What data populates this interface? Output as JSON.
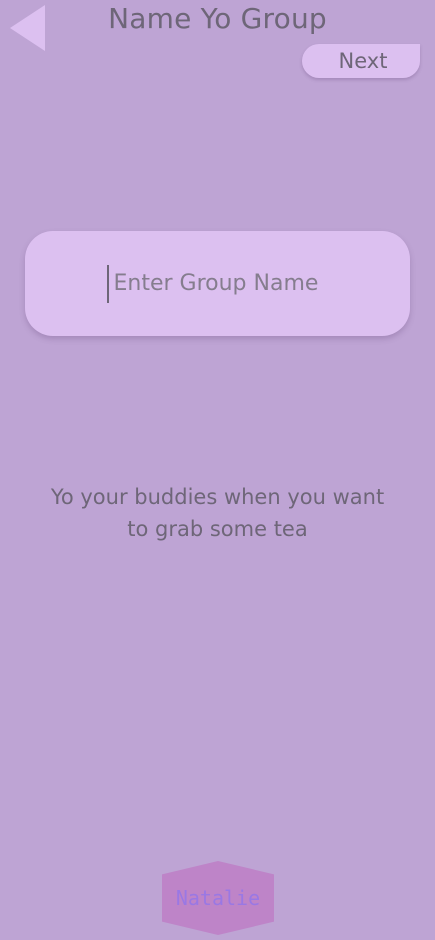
{
  "header": {
    "title": "Name Yo Group",
    "back_icon": "back-arrow-icon",
    "next_label": "Next"
  },
  "group_name": {
    "value": "",
    "placeholder": "Enter Group Name"
  },
  "tagline": "Yo your buddies when you want to grab some tea",
  "user": {
    "name": "Natalie"
  },
  "colors": {
    "background": "#bea4d4",
    "card": "#dcc0f0",
    "text": "#6e6678",
    "badge": "#be84c8",
    "badge_text": "#9a78e4"
  }
}
